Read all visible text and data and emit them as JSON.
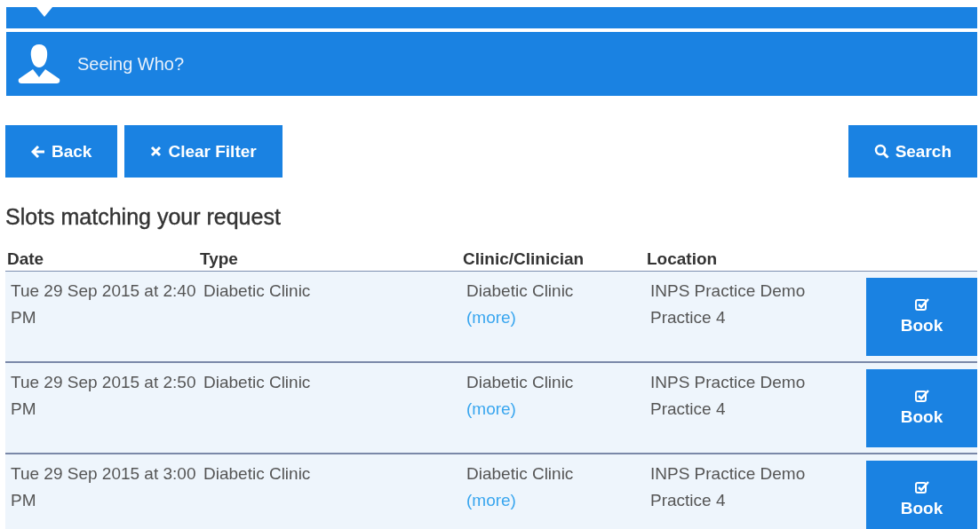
{
  "banner": {
    "title": "Seeing Who?"
  },
  "actions": [
    {
      "kind": "back",
      "label": "Back"
    },
    {
      "kind": "clear",
      "label": "Clear Filter"
    },
    {
      "kind": "search",
      "label": "Search"
    }
  ],
  "heading": "Slots matching your request",
  "table": {
    "columns": [
      "Date",
      "Type",
      "Clinic/Clinician",
      "Location"
    ],
    "rows": [
      {
        "date": "Tue 29 Sep 2015 at 2:40 PM",
        "type": "Diabetic Clinic",
        "clinic": "Diabetic Clinic",
        "more": "(more)",
        "location": "INPS Practice Demo Practice 4",
        "action": "Book"
      },
      {
        "date": "Tue 29 Sep 2015 at 2:50 PM",
        "type": "Diabetic Clinic",
        "clinic": "Diabetic Clinic",
        "more": "(more)",
        "location": "INPS Practice Demo Practice 4",
        "action": "Book"
      },
      {
        "date": "Tue 29 Sep 2015 at 3:00 PM",
        "type": "Diabetic Clinic",
        "clinic": "Diabetic Clinic",
        "more": "(more)",
        "location": "INPS Practice Demo Practice 4",
        "action": "Book"
      }
    ]
  }
}
